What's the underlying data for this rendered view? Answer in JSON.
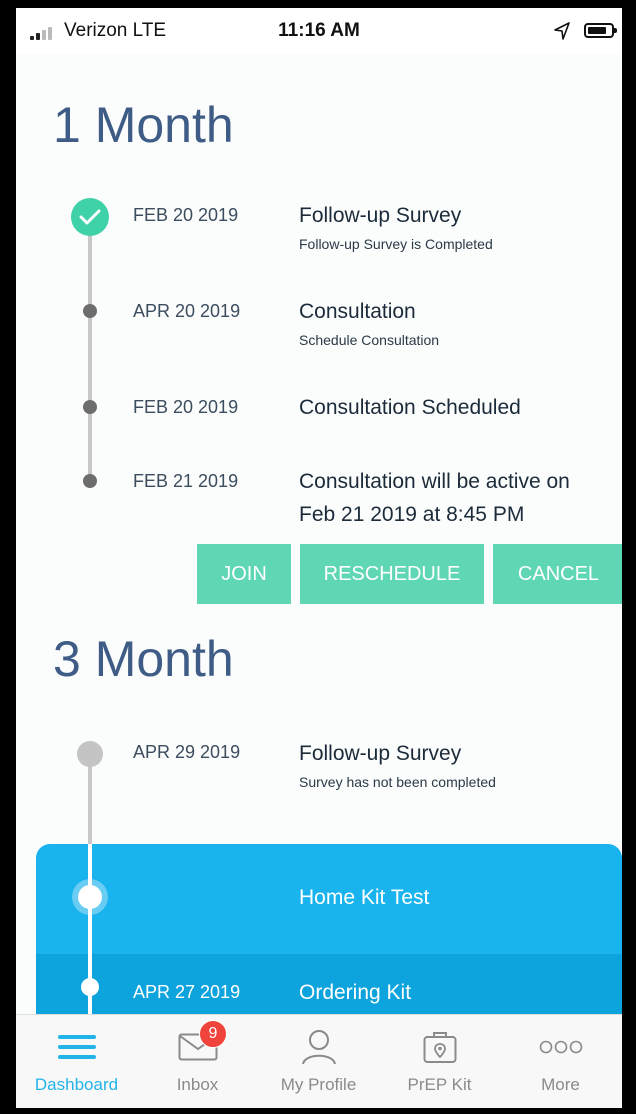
{
  "status_bar": {
    "carrier": "Verizon  LTE",
    "time": "11:16 AM"
  },
  "sections": [
    {
      "title": "1 Month",
      "events": [
        {
          "date": "FEB 20 2019",
          "title": "Follow-up Survey",
          "subtitle": "Follow-up Survey is Completed",
          "state": "completed"
        },
        {
          "date": "APR 20 2019",
          "title": "Consultation",
          "subtitle": "Schedule Consultation",
          "state": "pending"
        },
        {
          "date": "FEB 20 2019",
          "title": "Consultation Scheduled",
          "state": "pending"
        },
        {
          "date": "FEB 21 2019",
          "title_line1": "Consultation will be active on",
          "title_line2": "Feb 21 2019 at 8:45 PM",
          "state": "pending"
        }
      ],
      "actions": {
        "join": "JOIN",
        "reschedule": "RESCHEDULE",
        "cancel": "CANCEL"
      }
    },
    {
      "title": "3 Month",
      "events": [
        {
          "date": "APR 29 2019",
          "title": "Follow-up Survey",
          "subtitle": "Survey has not been completed",
          "state": "inactive"
        },
        {
          "title": "Home Kit Test",
          "state": "current"
        },
        {
          "date": "APR 27 2019",
          "title": "Ordering Kit",
          "state": "current-sub"
        }
      ]
    }
  ],
  "tab_bar": {
    "tabs": [
      {
        "label": "Dashboard",
        "icon": "dashboard-icon",
        "active": true
      },
      {
        "label": "Inbox",
        "icon": "inbox-icon",
        "badge": "9"
      },
      {
        "label": "My Profile",
        "icon": "profile-icon"
      },
      {
        "label": "PrEP Kit",
        "icon": "kit-icon"
      },
      {
        "label": "More",
        "icon": "more-icon"
      }
    ]
  },
  "colors": {
    "accent": "#22b4e8",
    "teal": "#5fd6b4",
    "check": "#3fd1a8",
    "highlight": "#19b3ed",
    "title": "#3e5c86",
    "badge": "#f0433b"
  }
}
